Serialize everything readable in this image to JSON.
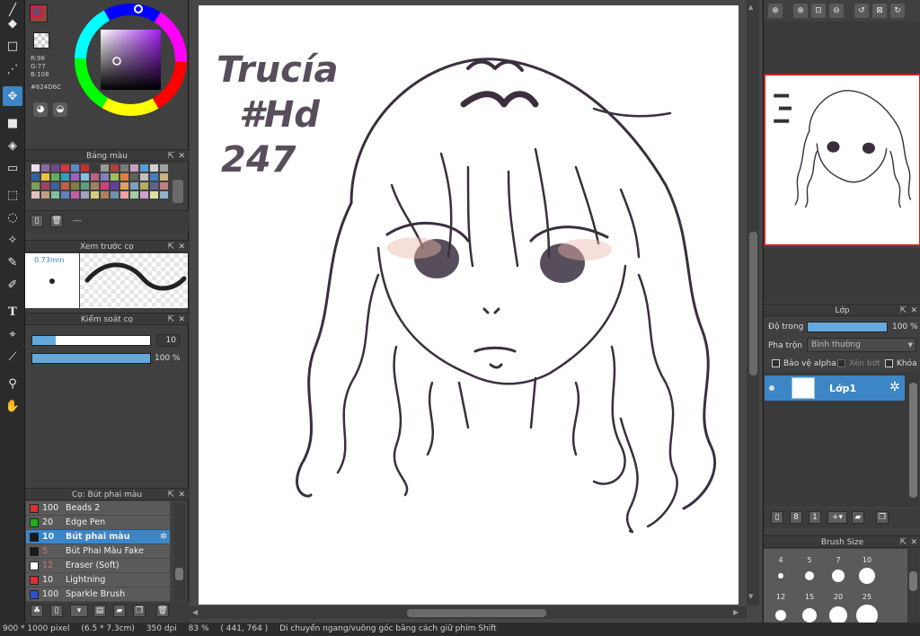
{
  "color": {
    "fg": "#624D6C",
    "bg": "#8B4A3A",
    "r_label": "R:98",
    "g_label": "G:77",
    "b_label": "B:108",
    "hex_label": "#624D6C"
  },
  "panels": {
    "palette_title": "Bảng màu",
    "palette_name": "---",
    "brush_preview_title": "Xem trước cọ",
    "brush_preview_size": "0.73mm",
    "brush_control_title": "Kiểm soát cọ",
    "brush_size_value": "10",
    "brush_size_fraction": 0.2,
    "brush_opacity_value": "100 %",
    "brush_opacity_fraction": 1.0,
    "brush_list_title": "Cọ: Bút phai màu",
    "brushes": [
      {
        "color": "#e03030",
        "size": "100",
        "name": "Beads 2",
        "selected": false
      },
      {
        "color": "#20b020",
        "size": "20",
        "name": "Edge Pen",
        "selected": false
      },
      {
        "color": "#1a1a1a",
        "size": "10",
        "name": "Bút phai màu",
        "selected": true
      },
      {
        "color": "#1a1a1a",
        "size": "5",
        "name": "Bút Phai Màu Fake",
        "selected": false
      },
      {
        "color": "#ffffff",
        "size": "12",
        "name": "Eraser (Soft)",
        "selected": false
      },
      {
        "color": "#e03030",
        "size": "10",
        "name": "Lightning",
        "selected": false
      },
      {
        "color": "#3050d0",
        "size": "100",
        "name": "Sparkle Brush",
        "selected": false
      }
    ]
  },
  "layers": {
    "title": "Lớp",
    "opacity_label": "Độ trong",
    "opacity_value": "100 %",
    "opacity_fraction": 1.0,
    "blend_label": "Pha trộn",
    "blend_value": "Bình thường",
    "protect_alpha": "Bảo vệ alpha",
    "clipping": "Xén bớt",
    "lock": "Khóa",
    "layer_name": "Lớp1"
  },
  "brush_size_panel": {
    "title": "Brush Size",
    "sizes_row1": [
      "4",
      "5",
      "7",
      "10"
    ],
    "sizes_row2": [
      "12",
      "15",
      "20",
      "25"
    ]
  },
  "canvas_text": {
    "line1": "Trucía",
    "line2": "#Hd",
    "line3": "247"
  },
  "status": {
    "dimensions": "900 * 1000 pixel",
    "physical": "(6.5 * 7.3cm)",
    "dpi": "350 dpi",
    "zoom": "83 %",
    "cursor": "( 441, 764 )",
    "hint": "Di chuyển ngang/vuông góc bằng cách giữ phím Shift"
  }
}
